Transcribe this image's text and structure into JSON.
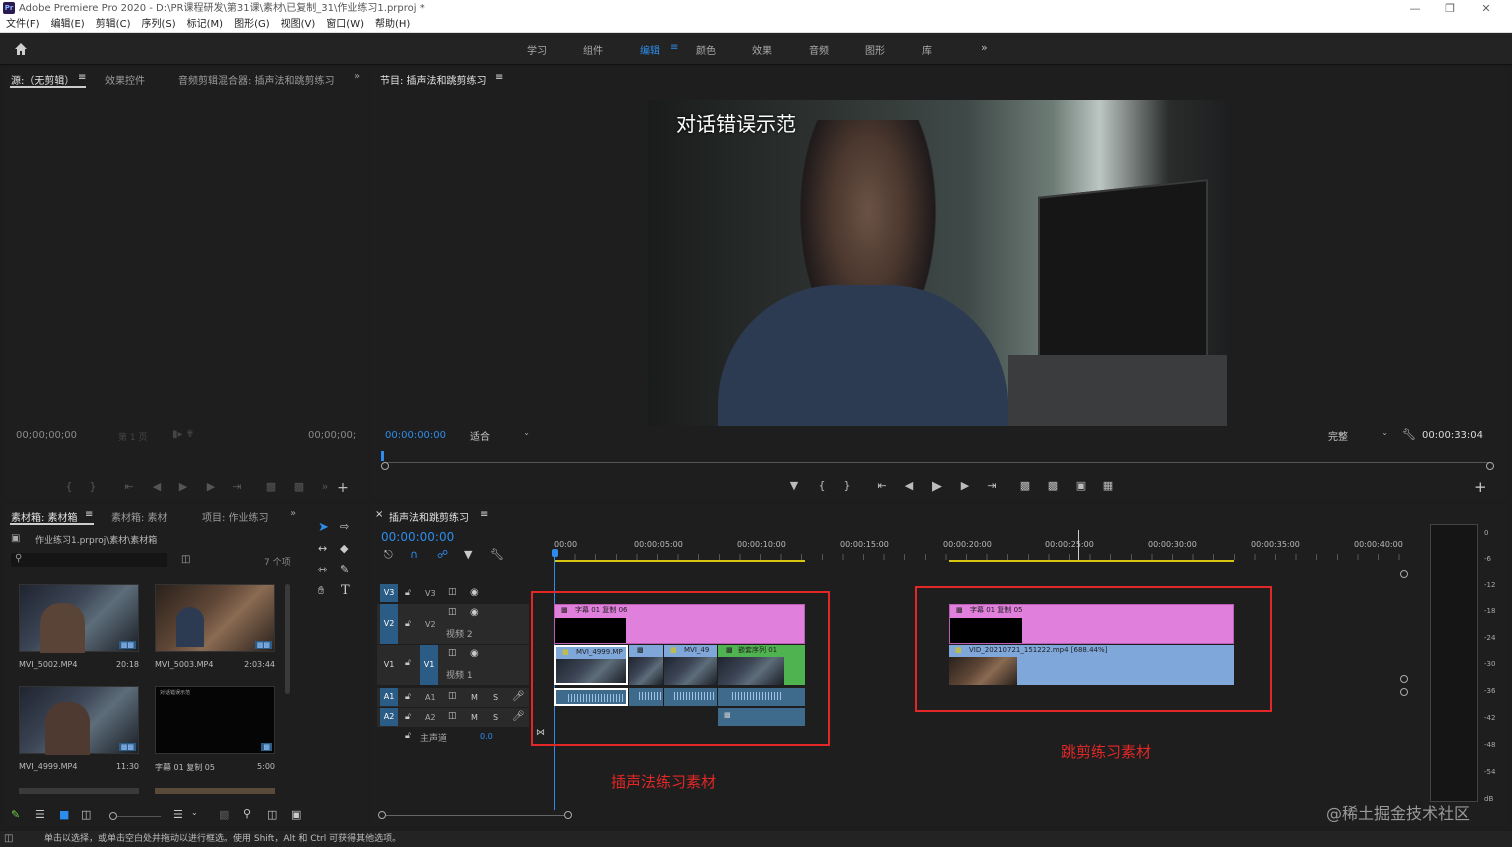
{
  "window": {
    "logo": "Pr",
    "title": "Adobe Premiere Pro 2020 - D:\\PR课程研发\\第31课\\素材\\已复制_31\\作业练习1.prproj *"
  },
  "menu": [
    "文件(F)",
    "编辑(E)",
    "剪辑(C)",
    "序列(S)",
    "标记(M)",
    "图形(G)",
    "视图(V)",
    "窗口(W)",
    "帮助(H)"
  ],
  "workspaces": {
    "items": [
      "学习",
      "组件",
      "编辑",
      "颜色",
      "效果",
      "音频",
      "图形",
      "库"
    ],
    "active": "编辑",
    "active_menu": "≡",
    "more": "»"
  },
  "source_panel": {
    "tabs": [
      "源:（无剪辑）",
      "效果控件",
      "音频剪辑混合器: 插声法和跳剪练习"
    ],
    "menu": "≡",
    "more": "»",
    "timecode_left": "00;00;00;00",
    "page_label": "第 1 页",
    "timecode_right": "00;00;00;"
  },
  "program_panel": {
    "title": "节目: 插声法和跳剪练习",
    "menu": "≡",
    "timecode": "00:00:00:00",
    "fit": "适合",
    "quality": "完整",
    "duration": "00:00:33:04",
    "subtitle": "对话错误示范"
  },
  "project_panel": {
    "tabs": [
      "素材箱: 素材箱",
      "素材箱: 素材",
      "项目: 作业练习"
    ],
    "menu": "≡",
    "more": "»",
    "path": "作业练习1.prproj\\素材\\素材箱",
    "item_count": "7 个项",
    "items": [
      {
        "name": "MVI_5002.MP4",
        "duration": "20:18"
      },
      {
        "name": "MVI_5003.MP4",
        "duration": "2:03:44"
      },
      {
        "name": "MVI_4999.MP4",
        "duration": "11:30"
      },
      {
        "name": "字幕 01 复制 05",
        "duration": "5:00"
      }
    ],
    "subtitle_thumb_text": "对话错误示范"
  },
  "timeline": {
    "close": "×",
    "title": "插声法和跳剪练习",
    "menu": "≡",
    "timecode": "00:00:00:00",
    "ruler": [
      "00:00",
      "00:00:05:00",
      "00:00:10:00",
      "00:00:15:00",
      "00:00:20:00",
      "00:00:25:00",
      "00:00:30:00",
      "00:00:35:00",
      "00:00:40:00"
    ],
    "tracks": {
      "v3": "V3",
      "v2": "V2",
      "v2_name": "视频 2",
      "v1": "V1",
      "v1_name": "视频 1",
      "a1": "A1",
      "a2": "A2",
      "master": "主声道",
      "master_val": "0.0",
      "m": "M",
      "s": "S"
    },
    "clips": {
      "title1": "字幕 01 复制 06",
      "v1_a": "MVI_4999.MP",
      "v1_b": "MVI_49",
      "v1_c": "嵌套序列 01",
      "title2": "字幕 01 复制 05",
      "v1_d": "VID_20210721_151222.mp4 [688.44%]"
    },
    "annotation_left": "插声法练习素材",
    "annotation_right": "跳剪练习素材"
  },
  "meter": {
    "labels": [
      "0",
      "-6",
      "-12",
      "-18",
      "-24",
      "-30",
      "-36",
      "-42",
      "-48",
      "-54",
      "dB"
    ]
  },
  "status": "单击以选择，或单击空白处并拖动以进行框选。使用 Shift，Alt 和 Ctrl 可获得其他选项。",
  "watermark": "@稀土掘金技术社区",
  "colors": {
    "accent": "#2d8ceb",
    "annotation": "#e32727",
    "title_clip": "#e17fdd",
    "video_clip": "#7fa7d9"
  }
}
